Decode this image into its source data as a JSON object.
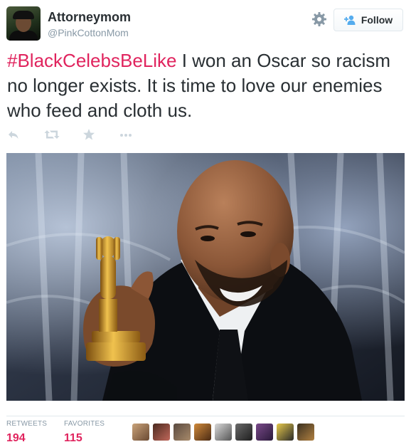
{
  "header": {
    "display_name": "Attorneymom",
    "handle": "@PinkCottonMom",
    "follow_label": "Follow",
    "settings_icon": "gear-icon",
    "follow_icon": "add-user-icon"
  },
  "tweet": {
    "hashtag": "#BlackCelebsBeLike",
    "text": " I won an Oscar so racism no longer exists. It is time to love our enemies who feed and cloth us."
  },
  "actions": [
    "reply-icon",
    "retweet-icon",
    "favorite-star-icon",
    "more-icon"
  ],
  "stats": {
    "retweets_label": "RETWEETS",
    "retweets_count": "194",
    "favorites_label": "FAVORITES",
    "favorites_count": "115"
  },
  "colors": {
    "hashtag": "#e0245e",
    "stat_value": "#e0245e",
    "muted": "#8899a6",
    "follow_icon": "#55acee",
    "action_icon": "#ccd6dd"
  },
  "favoriters_count_shown": 9
}
